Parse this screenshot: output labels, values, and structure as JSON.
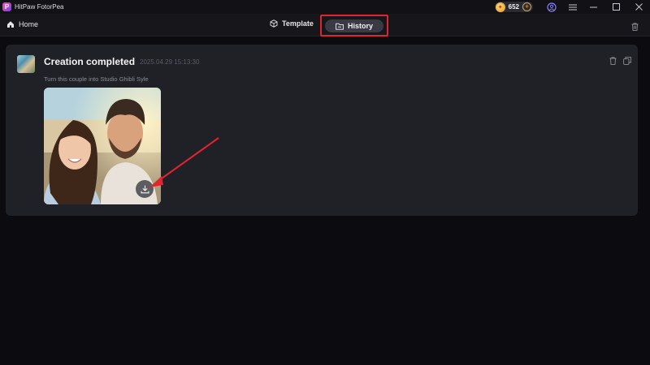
{
  "app": {
    "title": "HitPaw FotorPea",
    "logo_letter": "P"
  },
  "titlebar": {
    "credits": "652",
    "plus": "+"
  },
  "nav": {
    "home_label": "Home",
    "tabs": [
      {
        "label": "Template",
        "active": false
      },
      {
        "label": "History",
        "active": true
      }
    ]
  },
  "card": {
    "title": "Creation completed",
    "timestamp": "2025.04.29 15:13:30",
    "prompt": "Turn this couple into Studio Ghibli Syle"
  },
  "colors": {
    "highlight": "#e1252f",
    "accent": "#e9a43a",
    "background": "#0b0b10",
    "card": "#202027"
  },
  "icons": [
    "home-icon",
    "cube-icon",
    "folder-icon",
    "trash-icon",
    "copy-icon",
    "download-icon",
    "user-icon",
    "menu-icon",
    "minimize-icon",
    "maximize-icon",
    "close-icon"
  ]
}
